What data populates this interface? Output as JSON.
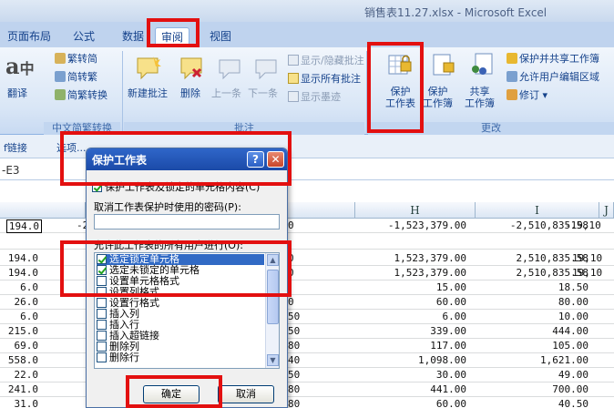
{
  "window": {
    "title": "销售表11.27.xlsx - Microsoft Excel"
  },
  "tabs": [
    {
      "label": "页面布局"
    },
    {
      "label": "公式"
    },
    {
      "label": "数据"
    },
    {
      "label": "审阅",
      "active": true
    },
    {
      "label": "视图"
    }
  ],
  "ribbon": {
    "translate": "翻译",
    "chinese_conv": {
      "to_simplified": "繁转简",
      "to_traditional": "简转繁",
      "convert": "简繁转换",
      "group": "中文简繁转换"
    },
    "comments": {
      "new": "新建批注",
      "delete": "删除",
      "prev": "上一条",
      "next": "下一条",
      "show_hide": "显示/隐藏批注",
      "show_all": "显示所有批注",
      "show_ink": "显示墨迹",
      "group": "批注"
    },
    "changes": {
      "protect_sheet": "保护\n工作表",
      "protect_sheet_l1": "保护",
      "protect_sheet_l2": "工作表",
      "protect_book_l1": "保护",
      "protect_book_l2": "工作簿",
      "share_l1": "共享",
      "share_l2": "工作簿",
      "protect_share": "保护并共享工作簿",
      "allow_edit": "允许用户编辑区域",
      "track": "修订",
      "group": "更改"
    }
  },
  "formula_bar": {
    "link_label": "f链接",
    "label2": "选项..."
  },
  "name_box": "-E3",
  "columns": {
    "H": "H",
    "I": "I",
    "J": "J"
  },
  "rows": [
    {
      "a": "194.0",
      "b": "-2",
      "g": "0",
      "h": "-1,523,379.00",
      "i": "-2,510,835.58",
      "j": "-19,10"
    },
    {
      "a": "",
      "b": "",
      "g": "",
      "h": "",
      "i": "",
      "j": ""
    },
    {
      "a": "194.0",
      "b": "",
      "g": "0",
      "h": "1,523,379.00",
      "i": "2,510,835.58",
      "j": "19,10"
    },
    {
      "a": "194.0",
      "b": "",
      "g": "0",
      "h": "1,523,379.00",
      "i": "2,510,835.58",
      "j": "19,10"
    },
    {
      "a": "6.0",
      "b": "",
      "g": "",
      "h": "15.00",
      "i": "18.50",
      "j": ""
    },
    {
      "a": "26.0",
      "b": "",
      "g": "0",
      "h": "60.00",
      "i": "80.00",
      "j": ""
    },
    {
      "a": "6.0",
      "b": "",
      "g": "50",
      "h": "6.00",
      "i": "10.00",
      "j": ""
    },
    {
      "a": "215.0",
      "b": "",
      "g": "50",
      "h": "339.00",
      "i": "444.00",
      "j": ""
    },
    {
      "a": "69.0",
      "b": "",
      "g": "80",
      "h": "117.00",
      "i": "105.00",
      "j": ""
    },
    {
      "a": "558.0",
      "b": "",
      "g": "40",
      "h": "1,098.00",
      "i": "1,621.00",
      "j": ""
    },
    {
      "a": "22.0",
      "b": "",
      "g": "50",
      "h": "30.00",
      "i": "49.00",
      "j": ""
    },
    {
      "a": "241.0",
      "b": "",
      "g": "80",
      "h": "441.00",
      "i": "700.00",
      "j": ""
    },
    {
      "a": "31.0",
      "b": "",
      "g": "80",
      "h": "60.00",
      "i": "40.50",
      "j": ""
    }
  ],
  "dialog": {
    "title": "保护工作表",
    "help": "?",
    "close": "✕",
    "protect_checkbox": "保护工作表及锁定的单元格内容(C)",
    "password_label": "取消工作表保护时使用的密码(P):",
    "password_value": "",
    "allow_label": "允许此工作表的所有用户进行(O):",
    "options": [
      {
        "label": "选定锁定单元格",
        "checked": true,
        "selected": true
      },
      {
        "label": "选定未锁定的单元格",
        "checked": true
      },
      {
        "label": "设置单元格格式",
        "checked": false
      },
      {
        "label": "设置列格式",
        "checked": false
      },
      {
        "label": "设置行格式",
        "checked": false
      },
      {
        "label": "插入列",
        "checked": false
      },
      {
        "label": "插入行",
        "checked": false
      },
      {
        "label": "插入超链接",
        "checked": false
      },
      {
        "label": "删除列",
        "checked": false
      },
      {
        "label": "删除行",
        "checked": false
      }
    ],
    "ok": "确定",
    "cancel": "取消"
  },
  "colors": {
    "highlight": "#e31010",
    "dialog_title": "#1b4aa8",
    "ribbon": "#d9e6f6"
  }
}
